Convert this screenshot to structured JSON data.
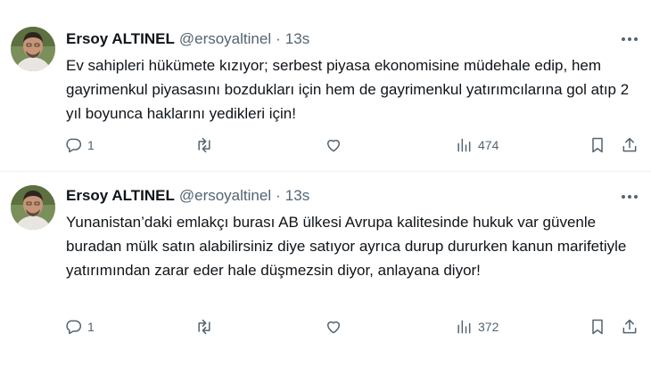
{
  "tweets": [
    {
      "author": {
        "name": "Ersoy ALTINEL",
        "handle": "@ersoyaltinel",
        "separator": "·",
        "time": "13s"
      },
      "text": "Ev sahipleri hükümete kızıyor; serbest piyasa ekonomisine müdehale edip, hem gayrimenkul piyasasını bozdukları için hem de gayrimenkul yatırımcılarına gol atıp 2 yıl boyunca haklarını yedikleri için!",
      "replies": "1",
      "views": "474"
    },
    {
      "author": {
        "name": "Ersoy ALTINEL",
        "handle": "@ersoyaltinel",
        "separator": "·",
        "time": "13s"
      },
      "text": "Yunanistan’daki emlakçı burası AB ülkesi Avrupa kalitesinde hukuk var güvenle buradan mülk satın alabilirsiniz diye satıyor ayrıca durup dururken kanun marifetiyle yatırımından zarar eder hale düşmezsin diyor, anlayana diyor!",
      "replies": "1",
      "views": "372"
    }
  ],
  "icons": {
    "more": "more-horizontal-icon",
    "reply": "reply-bubble-icon",
    "retweet": "retweet-icon",
    "like": "heart-icon",
    "views": "views-bar-chart-icon",
    "bookmark": "bookmark-icon",
    "share": "share-upload-icon"
  },
  "colors": {
    "text": "#0f1419",
    "secondary": "#536471",
    "divider": "#eff3f4"
  }
}
